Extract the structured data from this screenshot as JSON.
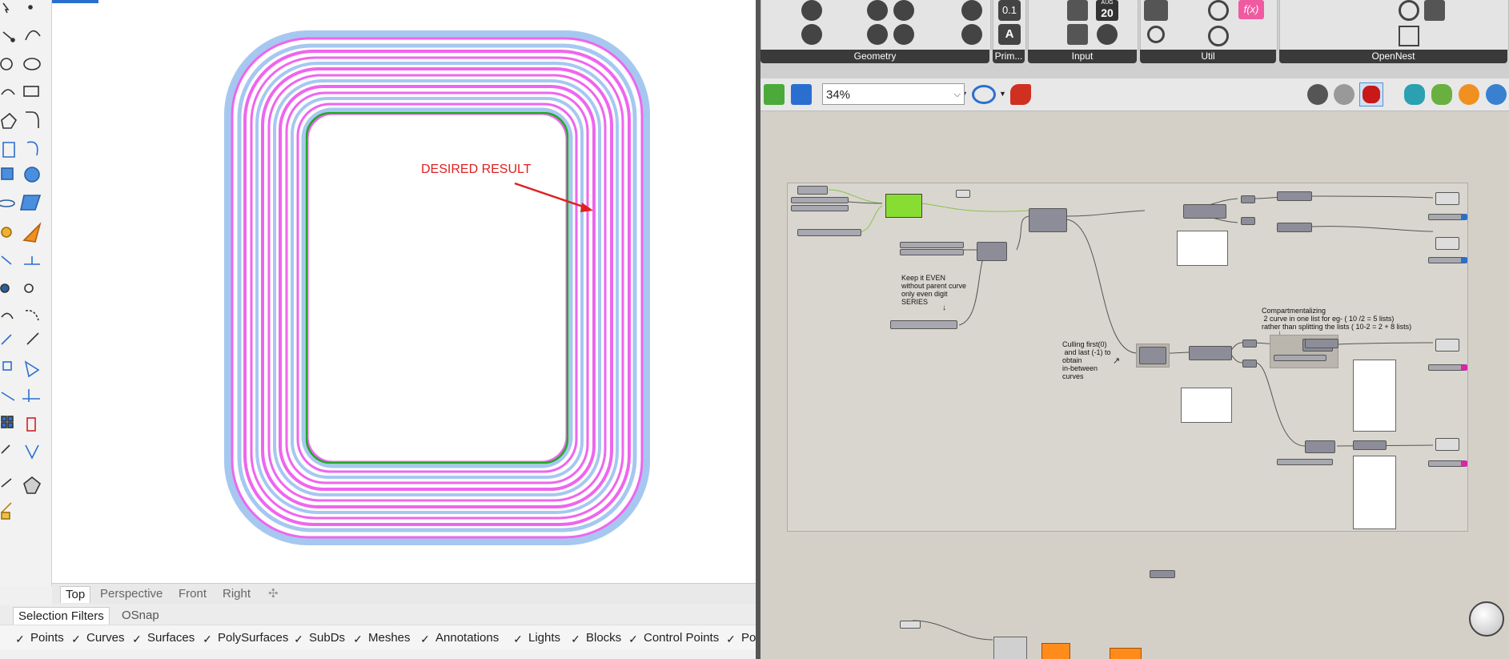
{
  "rhino": {
    "viewport_annotation": "DESIRED RESULT",
    "viewport_tabs": [
      "Top",
      "Perspective",
      "Front",
      "Right"
    ],
    "add_tab_glyph": "✣",
    "panel_tabs": [
      "Selection Filters",
      "OSnap"
    ],
    "filters": [
      {
        "label": "Points",
        "checked": true
      },
      {
        "label": "Curves",
        "checked": true
      },
      {
        "label": "Surfaces",
        "checked": true
      },
      {
        "label": "PolySurfaces",
        "checked": true
      },
      {
        "label": "SubDs",
        "checked": true
      },
      {
        "label": "Meshes",
        "checked": true
      },
      {
        "label": "Annotations",
        "checked": true
      },
      {
        "label": "Lights",
        "checked": true
      },
      {
        "label": "Blocks",
        "checked": true
      },
      {
        "label": "Control Points",
        "checked": true
      },
      {
        "label": "Po",
        "checked": true
      }
    ],
    "colors": {
      "curve_magenta": "#ee66ee",
      "curve_blue": "#a6c8f0",
      "inner_green": "#22aa22",
      "annotation_red": "#e02020"
    }
  },
  "grasshopper": {
    "ribbon_groups": [
      "Geometry",
      "Prim...",
      "Input",
      "Util",
      "OpenNest"
    ],
    "ribbon_icon_text": {
      "counter": "0.1",
      "letter": "A",
      "calendar_month": "AUG",
      "calendar_day": "20",
      "fx": "f(x)"
    },
    "zoom": "34%",
    "canvas_notes": [
      "Keep it EVEN\nwithout parent curve\nonly even digit\nSERIES",
      "Culling first(0)\n and last (-1) to\nobtain\nin-between\ncurves",
      "Compartmentalizing\n 2 curve in one list for eg- ( 10 /2 = 5 lists)\nrather than splitting the lists ( 10-2 = 2 + 8 lists)"
    ],
    "colors": {
      "canvas": "#d4d0c8",
      "component": "#8d8d99",
      "slider_green": "#88dd33",
      "orange": "#ff8c1a"
    }
  }
}
